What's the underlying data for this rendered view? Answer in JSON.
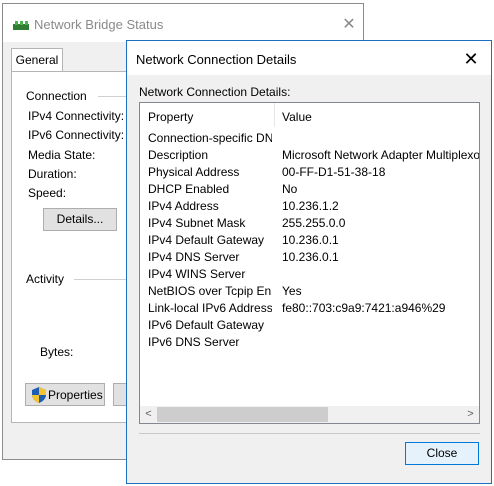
{
  "background_window": {
    "title": "Network Bridge Status",
    "close_glyph": "✕",
    "tab": "General",
    "connection": {
      "label": "Connection",
      "fields": [
        "IPv4 Connectivity:",
        "IPv6 Connectivity:",
        "Media State:",
        "Duration:",
        "Speed:"
      ],
      "details_button": "Details..."
    },
    "activity": {
      "label": "Activity",
      "bytes_label": "Bytes:"
    },
    "properties_button": "Properties",
    "icons": [
      "network-bridge-icon",
      "shield-icon"
    ]
  },
  "dialog": {
    "title": "Network Connection Details",
    "close_glyph": "✕",
    "caption": "Network Connection Details:",
    "columns": {
      "property": "Property",
      "value": "Value"
    },
    "rows": [
      {
        "property": "Connection-specific DN...",
        "value": ""
      },
      {
        "property": "Description",
        "value": "Microsoft Network Adapter Multiplexor Dri"
      },
      {
        "property": "Physical Address",
        "value": "00-FF-D1-51-38-18"
      },
      {
        "property": "DHCP Enabled",
        "value": "No"
      },
      {
        "property": "IPv4 Address",
        "value": "10.236.1.2"
      },
      {
        "property": "IPv4 Subnet Mask",
        "value": "255.255.0.0"
      },
      {
        "property": "IPv4 Default Gateway",
        "value": "10.236.0.1"
      },
      {
        "property": "IPv4 DNS Server",
        "value": "10.236.0.1"
      },
      {
        "property": "IPv4 WINS Server",
        "value": ""
      },
      {
        "property": "NetBIOS over Tcpip En...",
        "value": "Yes"
      },
      {
        "property": "Link-local IPv6 Address",
        "value": "fe80::703:c9a9:7421:a946%29"
      },
      {
        "property": "IPv6 Default Gateway",
        "value": ""
      },
      {
        "property": "IPv6 DNS Server",
        "value": ""
      }
    ],
    "scroll_left_glyph": "<",
    "scroll_right_glyph": ">",
    "close_button": "Close"
  },
  "colors": {
    "accent": "#0078d7",
    "dialog_border": "#1c70c4",
    "window_bg": "#f0f0f0"
  }
}
